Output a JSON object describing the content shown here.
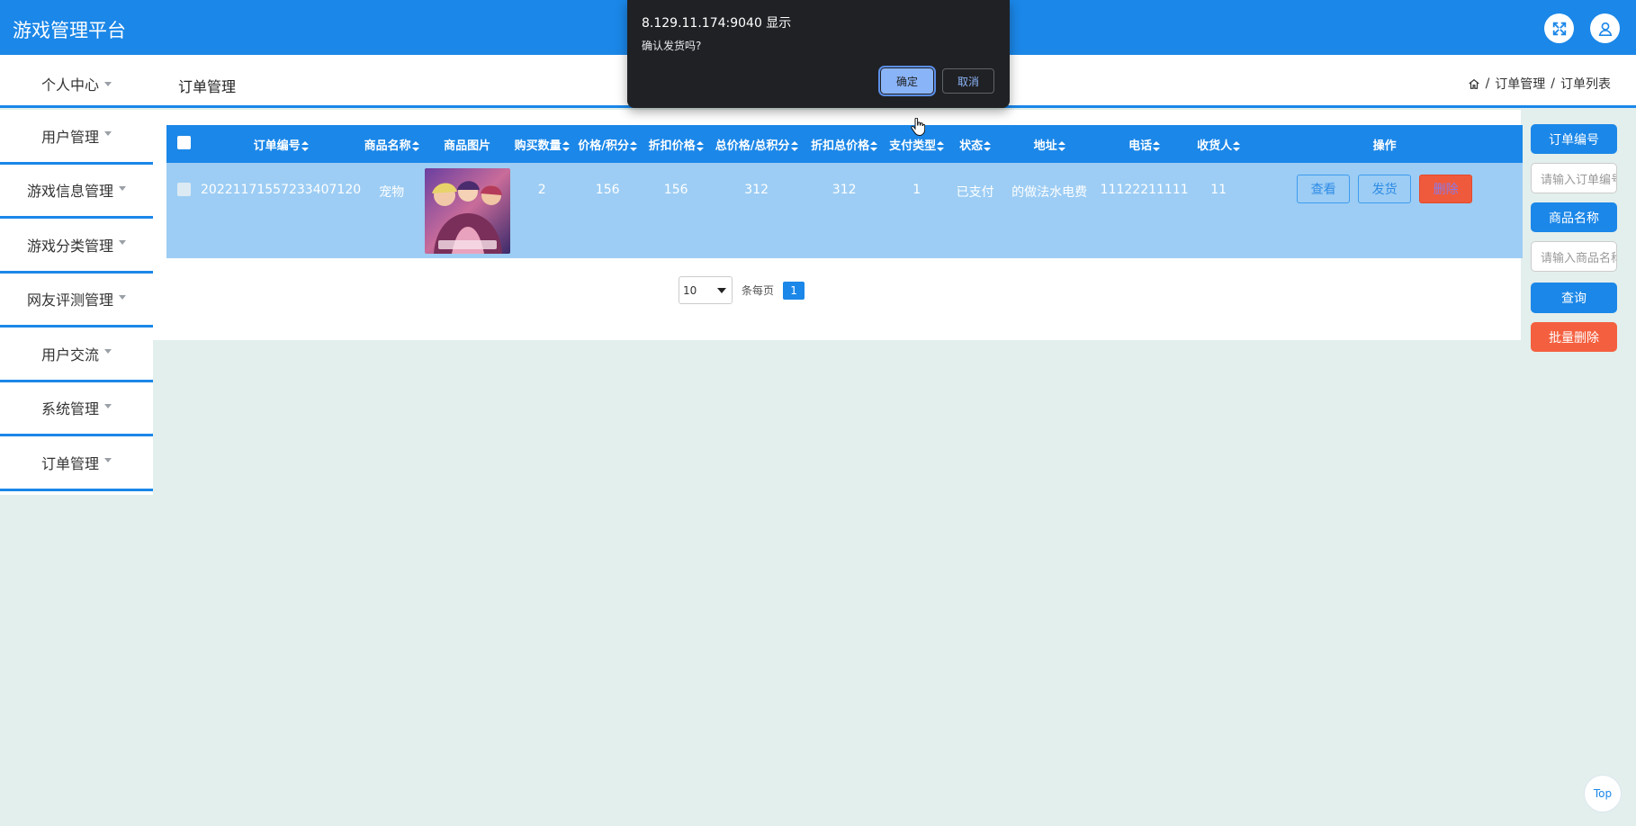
{
  "app": {
    "title": "游戏管理平台"
  },
  "header_icons": {
    "fullscreen": "fullscreen-icon",
    "user": "user-icon"
  },
  "subbar": {
    "personal_center": "个人中心",
    "page_title": "订单管理"
  },
  "breadcrumb": {
    "home_icon": "home-icon",
    "level1": "订单管理",
    "sep": "/",
    "level2": "订单列表"
  },
  "sidebar": {
    "items": [
      {
        "label": "用户管理"
      },
      {
        "label": "游戏信息管理"
      },
      {
        "label": "游戏分类管理"
      },
      {
        "label": "网友评测管理"
      },
      {
        "label": "用户交流"
      },
      {
        "label": "系统管理"
      },
      {
        "label": "订单管理"
      }
    ]
  },
  "table": {
    "headers": [
      "订单编号",
      "商品名称",
      "商品图片",
      "购买数量",
      "价格/积分",
      "折扣价格",
      "总价格/总积分",
      "折扣总价格",
      "支付类型",
      "状态",
      "地址",
      "电话",
      "收货人",
      "操作"
    ],
    "rows": [
      {
        "order_no": "20221171557233407120",
        "product_name": "宠物",
        "quantity": "2",
        "price": "156",
        "discount_price": "156",
        "total_price": "312",
        "discount_total": "312",
        "pay_type": "1",
        "status": "已支付",
        "address": "的做法水电费",
        "phone": "11122211111",
        "receiver": "11",
        "actions": {
          "view": "查看",
          "ship": "发货",
          "delete": "删除"
        }
      }
    ]
  },
  "pager": {
    "page_size": "10",
    "per_page_text": "条每页",
    "current_page": "1"
  },
  "search": {
    "order_no_button": "订单编号",
    "order_no_placeholder": "请输入订单编号",
    "product_name_button": "商品名称",
    "product_name_placeholder": "请输入商品名称",
    "query_button": "查询",
    "batch_delete_button": "批量删除"
  },
  "top_button": "Top",
  "dialog": {
    "origin": "8.129.11.174:9040 显示",
    "message": "确认发货吗?",
    "ok": "确定",
    "cancel": "取消"
  },
  "colors": {
    "primary": "#1b87e8",
    "row_bg": "#9dcdf4",
    "danger": "#f4603f",
    "page_bg": "#e3efec",
    "dialog_bg": "#202124"
  }
}
